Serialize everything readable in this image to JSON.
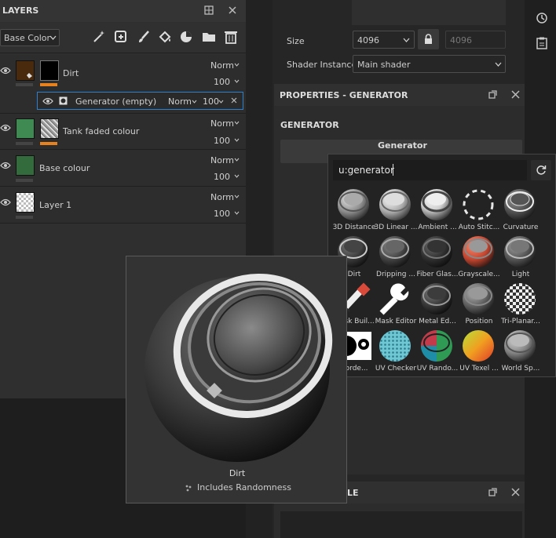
{
  "layers_panel": {
    "title": "LAYERS",
    "channel_select": "Base Color",
    "layers": [
      {
        "name": "Dirt",
        "blend": "Norm",
        "opacity": "100"
      },
      {
        "name": "Generator (empty)",
        "blend": "Norm",
        "opacity": "100"
      },
      {
        "name": "Tank faded colour",
        "blend": "Norm",
        "opacity": "100"
      },
      {
        "name": "Base colour",
        "blend": "Norm",
        "opacity": "100"
      },
      {
        "name": "Layer 1",
        "blend": "Norm",
        "opacity": "100"
      }
    ]
  },
  "texture_settings": {
    "size_label": "Size",
    "size_value": "4096",
    "size_linked_value": "4096",
    "shader_label": "Shader Instance",
    "shader_value": "Main shader"
  },
  "properties": {
    "title": "PROPERTIES - GENERATOR",
    "section": "GENERATOR",
    "generator_button": "Generator"
  },
  "bottom_panel": {
    "title_fragment": "LE"
  },
  "picker": {
    "search_value": "u:generator",
    "items": [
      "3D Distance",
      "3D Linear ...",
      "Ambient ...",
      "Auto Stitc...",
      "Curvature",
      "Dirt",
      "Dripping ...",
      "Fiber Glas...",
      "Grayscale...",
      "Light",
      "Mask Buil...",
      "Mask Editor",
      "Metal Ed...",
      "Position",
      "Tri-Planar...",
      "Borde...",
      "UV Checker",
      "UV Rando...",
      "UV Texel ...",
      "World Sp..."
    ]
  },
  "tooltip": {
    "name": "Dirt",
    "note": "Includes Randomness"
  },
  "colors": {
    "accent_orange": "#e8821e",
    "selection_blue": "#2f7fcf"
  }
}
